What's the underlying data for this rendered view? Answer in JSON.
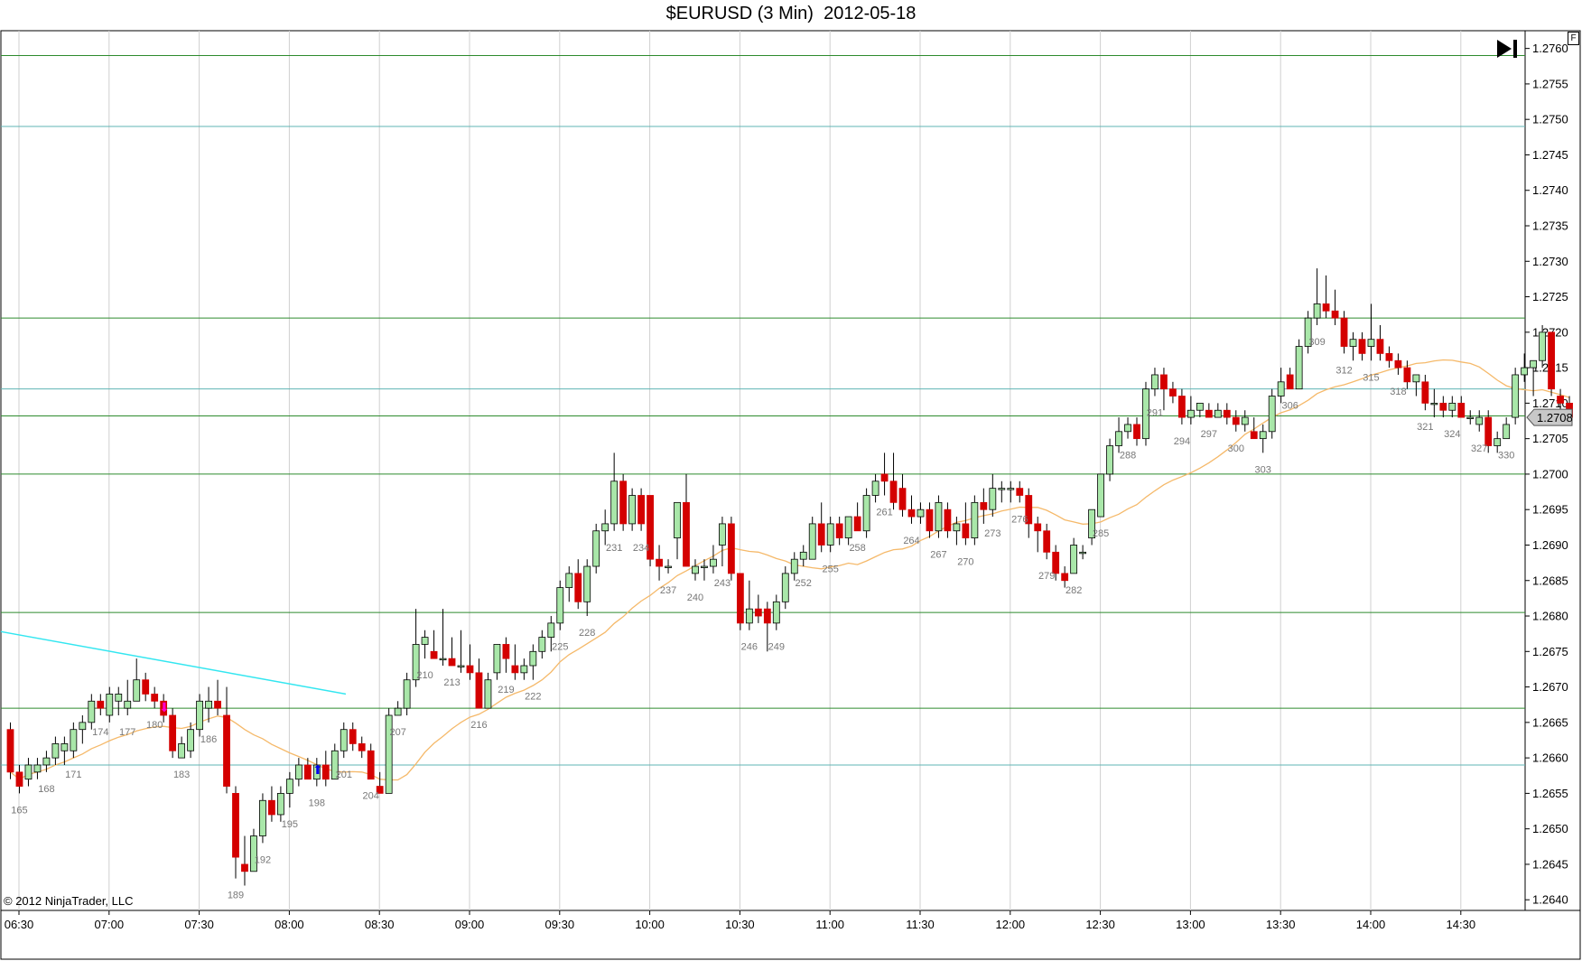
{
  "title": "$EURUSD (3 Min)  2012-05-18",
  "copyright": "© 2012 NinjaTrader, LLC",
  "f_button_label": "F",
  "current_price_label": "1.2708",
  "colors": {
    "up": "#a9e7a9",
    "down": "#d40000",
    "ma": "#f5b96a",
    "trend": "#33e6f0",
    "hline_green": "#2e8b2e",
    "hline_teal": "#5fb5b5",
    "grid": "#cfcfcf"
  },
  "chart_data": {
    "type": "candlestick",
    "title": "$EURUSD (3 Min)  2012-05-18",
    "x_tick_labels": [
      "06:30",
      "07:00",
      "07:30",
      "08:00",
      "08:30",
      "09:00",
      "09:30",
      "10:00",
      "10:30",
      "11:00",
      "11:30",
      "12:00",
      "12:30",
      "13:00",
      "13:30",
      "14:00",
      "14:30"
    ],
    "y_tick_labels": [
      "1.2640",
      "1.2645",
      "1.2650",
      "1.2655",
      "1.2660",
      "1.2665",
      "1.2670",
      "1.2675",
      "1.2680",
      "1.2685",
      "1.2690",
      "1.2695",
      "1.2700",
      "1.2705",
      "1.2710",
      "1.2715",
      "1.2720",
      "1.2725",
      "1.2730",
      "1.2735",
      "1.2740",
      "1.2745",
      "1.2750",
      "1.2755",
      "1.2760"
    ],
    "ylim": [
      1.26385,
      1.27625
    ],
    "first_bar": 164,
    "bars_ohlc": [
      [
        1.2664,
        1.2665,
        1.2657,
        1.2658
      ],
      [
        1.2658,
        1.2659,
        1.2655,
        1.2656
      ],
      [
        1.2657,
        1.266,
        1.2656,
        1.2659
      ],
      [
        1.2658,
        1.266,
        1.2657,
        1.2659
      ],
      [
        1.2659,
        1.2661,
        1.2658,
        1.266
      ],
      [
        1.266,
        1.2663,
        1.2659,
        1.2662
      ],
      [
        1.2661,
        1.2663,
        1.2659,
        1.2662
      ],
      [
        1.2661,
        1.2665,
        1.266,
        1.2664
      ],
      [
        1.2664,
        1.2666,
        1.2662,
        1.2665
      ],
      [
        1.2665,
        1.2669,
        1.2664,
        1.2668
      ],
      [
        1.2668,
        1.2669,
        1.2666,
        1.2667
      ],
      [
        1.2666,
        1.267,
        1.2665,
        1.2669
      ],
      [
        1.2668,
        1.267,
        1.2666,
        1.2669
      ],
      [
        1.2667,
        1.2671,
        1.2666,
        1.2668
      ],
      [
        1.2668,
        1.2674,
        1.2668,
        1.2671
      ],
      [
        1.2671,
        1.2672,
        1.2668,
        1.2669
      ],
      [
        1.2669,
        1.267,
        1.2667,
        1.2668
      ],
      [
        1.2668,
        1.2669,
        1.2665,
        1.2666
      ],
      [
        1.2666,
        1.2667,
        1.266,
        1.2661
      ],
      [
        1.266,
        1.2663,
        1.266,
        1.2662
      ],
      [
        1.2661,
        1.2665,
        1.266,
        1.2664
      ],
      [
        1.2664,
        1.2669,
        1.2663,
        1.2668
      ],
      [
        1.2667,
        1.267,
        1.2665,
        1.2668
      ],
      [
        1.2668,
        1.2671,
        1.2666,
        1.2667
      ],
      [
        1.2666,
        1.267,
        1.2655,
        1.2656
      ],
      [
        1.2655,
        1.2656,
        1.2643,
        1.2646
      ],
      [
        1.2645,
        1.2649,
        1.2642,
        1.2644
      ],
      [
        1.2644,
        1.265,
        1.2644,
        1.2649
      ],
      [
        1.2649,
        1.2655,
        1.2648,
        1.2654
      ],
      [
        1.2654,
        1.2656,
        1.2651,
        1.2652
      ],
      [
        1.2652,
        1.2656,
        1.2651,
        1.2655
      ],
      [
        1.2655,
        1.2658,
        1.2653,
        1.2657
      ],
      [
        1.2657,
        1.266,
        1.2656,
        1.2659
      ],
      [
        1.2659,
        1.266,
        1.2657,
        1.2657
      ],
      [
        1.2657,
        1.266,
        1.2656,
        1.2659
      ],
      [
        1.2659,
        1.2661,
        1.2656,
        1.2657
      ],
      [
        1.2657,
        1.2662,
        1.2657,
        1.2661
      ],
      [
        1.2661,
        1.2665,
        1.266,
        1.2664
      ],
      [
        1.2664,
        1.2665,
        1.2661,
        1.2662
      ],
      [
        1.2662,
        1.2663,
        1.266,
        1.2661
      ],
      [
        1.2661,
        1.2662,
        1.2657,
        1.2657
      ],
      [
        1.2656,
        1.2658,
        1.2655,
        1.2655
      ],
      [
        1.2655,
        1.2667,
        1.2655,
        1.2666
      ],
      [
        1.2666,
        1.2668,
        1.2666,
        1.2667
      ],
      [
        1.2667,
        1.2672,
        1.2666,
        1.2671
      ],
      [
        1.2671,
        1.2681,
        1.267,
        1.2676
      ],
      [
        1.2676,
        1.2678,
        1.2674,
        1.2677
      ],
      [
        1.2675,
        1.2678,
        1.2674,
        1.2674
      ],
      [
        1.2674,
        1.2681,
        1.2673,
        1.2674
      ],
      [
        1.2674,
        1.2677,
        1.2673,
        1.2673
      ],
      [
        1.2673,
        1.2678,
        1.2672,
        1.2673
      ],
      [
        1.2673,
        1.2676,
        1.2671,
        1.2672
      ],
      [
        1.2672,
        1.2674,
        1.2667,
        1.2667
      ],
      [
        1.2667,
        1.2672,
        1.2667,
        1.2671
      ],
      [
        1.2672,
        1.2676,
        1.2671,
        1.2676
      ],
      [
        1.2676,
        1.2677,
        1.2672,
        1.2674
      ],
      [
        1.2673,
        1.2676,
        1.2671,
        1.2672
      ],
      [
        1.2672,
        1.2674,
        1.2671,
        1.2673
      ],
      [
        1.2673,
        1.2676,
        1.2671,
        1.2675
      ],
      [
        1.2675,
        1.2678,
        1.2674,
        1.2677
      ],
      [
        1.2677,
        1.268,
        1.2675,
        1.2679
      ],
      [
        1.2679,
        1.2685,
        1.2678,
        1.2684
      ],
      [
        1.2684,
        1.2687,
        1.2682,
        1.2686
      ],
      [
        1.2686,
        1.2688,
        1.2681,
        1.2682
      ],
      [
        1.2682,
        1.2688,
        1.268,
        1.2687
      ],
      [
        1.2687,
        1.2693,
        1.2686,
        1.2692
      ],
      [
        1.2692,
        1.2695,
        1.269,
        1.2693
      ],
      [
        1.2693,
        1.2703,
        1.2692,
        1.2699
      ],
      [
        1.2699,
        1.27,
        1.2692,
        1.2693
      ],
      [
        1.2693,
        1.2698,
        1.2692,
        1.2697
      ],
      [
        1.2697,
        1.2698,
        1.2692,
        1.2693
      ],
      [
        1.2697,
        1.2697,
        1.2687,
        1.2688
      ],
      [
        1.2688,
        1.269,
        1.2685,
        1.2687
      ],
      [
        1.2687,
        1.2688,
        1.2686,
        1.2687
      ],
      [
        1.2691,
        1.2696,
        1.2688,
        1.2696
      ],
      [
        1.2696,
        1.27,
        1.2687,
        1.2687
      ],
      [
        1.2686,
        1.2688,
        1.2685,
        1.2687
      ],
      [
        1.2687,
        1.2688,
        1.2685,
        1.2687
      ],
      [
        1.2687,
        1.269,
        1.2686,
        1.2688
      ],
      [
        1.269,
        1.2694,
        1.2687,
        1.2693
      ],
      [
        1.2693,
        1.2694,
        1.2685,
        1.2686
      ],
      [
        1.2686,
        1.2686,
        1.2678,
        1.2679
      ],
      [
        1.2679,
        1.2685,
        1.2678,
        1.2681
      ],
      [
        1.2681,
        1.2683,
        1.2679,
        1.268
      ],
      [
        1.2681,
        1.2682,
        1.2675,
        1.2679
      ],
      [
        1.2679,
        1.2683,
        1.2678,
        1.2682
      ],
      [
        1.2682,
        1.2687,
        1.2681,
        1.2686
      ],
      [
        1.2686,
        1.2689,
        1.2685,
        1.2688
      ],
      [
        1.2688,
        1.269,
        1.2687,
        1.2689
      ],
      [
        1.2688,
        1.2694,
        1.2688,
        1.2693
      ],
      [
        1.2693,
        1.2696,
        1.2689,
        1.269
      ],
      [
        1.269,
        1.2694,
        1.2689,
        1.2693
      ],
      [
        1.2693,
        1.2694,
        1.269,
        1.2691
      ],
      [
        1.2691,
        1.2694,
        1.269,
        1.2694
      ],
      [
        1.2694,
        1.2696,
        1.2692,
        1.2692
      ],
      [
        1.2692,
        1.2698,
        1.2691,
        1.2697
      ],
      [
        1.2697,
        1.27,
        1.2696,
        1.2699
      ],
      [
        1.27,
        1.2703,
        1.2697,
        1.2699
      ],
      [
        1.2699,
        1.2703,
        1.2695,
        1.2696
      ],
      [
        1.2698,
        1.27,
        1.2694,
        1.2695
      ],
      [
        1.2695,
        1.2697,
        1.2693,
        1.2694
      ],
      [
        1.2694,
        1.2696,
        1.2693,
        1.2695
      ],
      [
        1.2695,
        1.2696,
        1.2691,
        1.2692
      ],
      [
        1.2692,
        1.2697,
        1.2691,
        1.2696
      ],
      [
        1.2695,
        1.2696,
        1.2691,
        1.2692
      ],
      [
        1.2692,
        1.2694,
        1.269,
        1.2693
      ],
      [
        1.2693,
        1.2696,
        1.269,
        1.2691
      ],
      [
        1.2691,
        1.2697,
        1.269,
        1.2696
      ],
      [
        1.2696,
        1.2698,
        1.2693,
        1.2695
      ],
      [
        1.2695,
        1.27,
        1.2694,
        1.2698
      ],
      [
        1.2698,
        1.2699,
        1.2696,
        1.2698
      ],
      [
        1.2698,
        1.2699,
        1.2696,
        1.2698
      ],
      [
        1.2698,
        1.2699,
        1.2696,
        1.2697
      ],
      [
        1.2697,
        1.2698,
        1.2691,
        1.2693
      ],
      [
        1.2693,
        1.2694,
        1.2689,
        1.2692
      ],
      [
        1.2692,
        1.2693,
        1.2688,
        1.2689
      ],
      [
        1.2689,
        1.269,
        1.2685,
        1.2686
      ],
      [
        1.2686,
        1.2687,
        1.2684,
        1.2685
      ],
      [
        1.2686,
        1.2691,
        1.2686,
        1.269
      ],
      [
        1.2689,
        1.269,
        1.2688,
        1.2689
      ],
      [
        1.2691,
        1.2695,
        1.269,
        1.2695
      ],
      [
        1.2694,
        1.27,
        1.2694,
        1.27
      ],
      [
        1.27,
        1.2705,
        1.2699,
        1.2704
      ],
      [
        1.2704,
        1.2708,
        1.2703,
        1.2706
      ],
      [
        1.2706,
        1.2708,
        1.2705,
        1.2707
      ],
      [
        1.2707,
        1.2708,
        1.2704,
        1.2705
      ],
      [
        1.2705,
        1.2713,
        1.2704,
        1.2712
      ],
      [
        1.2712,
        1.2715,
        1.2711,
        1.2714
      ],
      [
        1.2714,
        1.2715,
        1.2709,
        1.2712
      ],
      [
        1.2712,
        1.2713,
        1.271,
        1.2711
      ],
      [
        1.2711,
        1.2712,
        1.2707,
        1.2708
      ],
      [
        1.2708,
        1.2711,
        1.2707,
        1.2709
      ],
      [
        1.2709,
        1.271,
        1.2708,
        1.271
      ],
      [
        1.2709,
        1.271,
        1.2708,
        1.2708
      ],
      [
        1.2708,
        1.271,
        1.2708,
        1.2709
      ],
      [
        1.2709,
        1.271,
        1.2707,
        1.2708
      ],
      [
        1.2708,
        1.2709,
        1.2706,
        1.2707
      ],
      [
        1.2707,
        1.2709,
        1.2706,
        1.2708
      ],
      [
        1.2706,
        1.2708,
        1.2705,
        1.2705
      ],
      [
        1.2705,
        1.2707,
        1.2703,
        1.2706
      ],
      [
        1.2706,
        1.2712,
        1.2705,
        1.2711
      ],
      [
        1.2711,
        1.2715,
        1.271,
        1.2713
      ],
      [
        1.2714,
        1.2715,
        1.2712,
        1.2712
      ],
      [
        1.2712,
        1.2719,
        1.2712,
        1.2718
      ],
      [
        1.2718,
        1.2723,
        1.2717,
        1.2722
      ],
      [
        1.2722,
        1.2729,
        1.2721,
        1.2724
      ],
      [
        1.2724,
        1.2728,
        1.2722,
        1.2723
      ],
      [
        1.2723,
        1.2726,
        1.2721,
        1.2722
      ],
      [
        1.2722,
        1.2723,
        1.2717,
        1.2718
      ],
      [
        1.2718,
        1.272,
        1.2716,
        1.2719
      ],
      [
        1.2719,
        1.272,
        1.2716,
        1.2717
      ],
      [
        1.2718,
        1.2724,
        1.2716,
        1.2719
      ],
      [
        1.2719,
        1.2721,
        1.2716,
        1.2717
      ],
      [
        1.2717,
        1.2718,
        1.2715,
        1.2716
      ],
      [
        1.2716,
        1.2717,
        1.2714,
        1.2715
      ],
      [
        1.2715,
        1.2716,
        1.2712,
        1.2713
      ],
      [
        1.2713,
        1.2714,
        1.2711,
        1.2714
      ],
      [
        1.2713,
        1.2714,
        1.2709,
        1.271
      ],
      [
        1.271,
        1.2712,
        1.2708,
        1.271
      ],
      [
        1.271,
        1.2711,
        1.2708,
        1.2709
      ],
      [
        1.2709,
        1.2711,
        1.2708,
        1.271
      ],
      [
        1.271,
        1.2711,
        1.2708,
        1.2708
      ],
      [
        1.2708,
        1.2709,
        1.2707,
        1.2708
      ],
      [
        1.2707,
        1.2709,
        1.2706,
        1.2708
      ],
      [
        1.2708,
        1.2709,
        1.2703,
        1.2704
      ],
      [
        1.2704,
        1.2706,
        1.2703,
        1.2705
      ],
      [
        1.2705,
        1.2708,
        1.2705,
        1.2707
      ],
      [
        1.2708,
        1.2715,
        1.2707,
        1.2714
      ],
      [
        1.2714,
        1.2717,
        1.2713,
        1.2715
      ],
      [
        1.2715,
        1.2716,
        1.2711,
        1.2716
      ],
      [
        1.2716,
        1.2721,
        1.2715,
        1.272
      ],
      [
        1.272,
        1.272,
        1.2711,
        1.2712
      ],
      [
        1.2711,
        1.2712,
        1.2709,
        1.271
      ],
      [
        1.271,
        1.2711,
        1.2707,
        1.2708
      ]
    ],
    "bar_number_labels": [
      "165",
      "168",
      "171",
      "174",
      "177",
      "180",
      "183",
      "186",
      "189",
      "192",
      "195",
      "198",
      "201",
      "204",
      "207",
      "210",
      "213",
      "216",
      "219",
      "222",
      "225",
      "228",
      "231",
      "234",
      "237",
      "240",
      "243",
      "246",
      "249",
      "252",
      "255",
      "258",
      "261",
      "264",
      "267",
      "270",
      "273",
      "276",
      "279",
      "282",
      "285",
      "288",
      "291",
      "294",
      "297",
      "300",
      "303",
      "306",
      "309",
      "312",
      "315",
      "318",
      "321",
      "324",
      "327",
      "330"
    ],
    "horizontal_lines_green": [
      1.2759,
      1.2722,
      1.27082,
      1.27,
      1.26805,
      1.2667
    ],
    "horizontal_lines_teal": [
      1.2749,
      1.2712,
      1.2659
    ],
    "trendline": [
      [
        0,
        1.26778
      ],
      [
        1.2669
      ]
    ],
    "ma_type": "line",
    "grid": true,
    "current_price": 1.2708
  }
}
